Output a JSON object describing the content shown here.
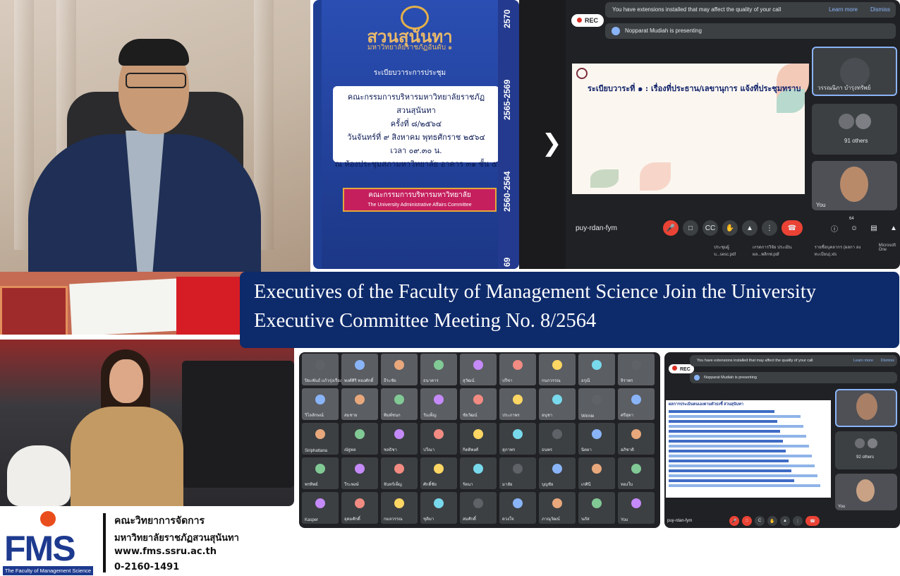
{
  "cover": {
    "brand_thai": "สวนสุนันทา",
    "brand_sub": "มหาวิทยาลัยราชภัฏอันดับ ๑",
    "agenda_heading": "ระเบียบวาระการประชุม",
    "lines": [
      "คณะกรรมการบริหารมหาวิทยาลัยราชภัฏสวนสุนันทา",
      "ครั้งที่ ๘/๒๕๖๔",
      "วันจันทร์ที่ ๙ สิงหาคม พุทธศักราช ๒๕๖๔",
      "เวลา ๐๙.๓๐ น.",
      "ณ ห้องประชุมสภามหาวิทยาลัย อาคาร ๓๑ ชั้น ๕"
    ],
    "ribbon_thai": "คณะกรรมการบริหารมหาวิทยาลัย",
    "ribbon_en": "The University Administrative Affairs Committee",
    "spine": [
      "2570",
      "2565-2569",
      "2560-2564",
      "69"
    ]
  },
  "meeting1": {
    "rec_label": "REC",
    "ext_text": "You have extensions installed that may affect the quality of your call",
    "learn_more": "Learn more",
    "dismiss": "Dismiss",
    "presenting": "Nopparat Mudiah is presenting",
    "slide_title": "ระเบียบวาระที่ ๑ : เรื่องที่ประธาน/เลขานุการ แจ้งที่ประชุมทราบ",
    "tile1_name": "วรรณนิภา บำรุงทรัพย์",
    "others": "91 others",
    "you": "You",
    "code": "puy-rdan-fym",
    "participant_count": "64",
    "files": [
      "ประชุมผู้บ...sesc.pdf",
      "เกรดการวิจัย ประเมินผล...พลิกฟ.pdf",
      "รายชื่อบุคลากร (ผลกา ลงทะเบียน).xls",
      "Microsoft One"
    ]
  },
  "banner": {
    "line1": "Executives of the Faculty of Management Science Join the University",
    "line2": "Executive Committee Meeting No. 8/2564"
  },
  "grid": {
    "rows": [
      [
        "ปิยะพันธ์ แก้วรุ่งเรือง",
        "พงศ์ศิริ ทองศักดิ์",
        "ธีระชัย",
        "ธนาคาร",
        "สุวัฒน์",
        "ปรีชา",
        "กนกวรรณ",
        "อรุณี",
        "จิราพร"
      ],
      [
        "วิไลลักษณ์",
        "สมชาย",
        "พิมพ์ชนก",
        "วันเพ็ญ",
        "ชัยวัฒน์",
        "ประภาพร",
        "อนุชา",
        "Winnie",
        "ศรีสุดา"
      ],
      [
        "Siriphattana",
        "ณัฐพล",
        "ชลธิชา",
        "ปวีณา",
        "กิตติพงศ์",
        "สุภาพร",
        "ธนพร",
        "นิตยา",
        "อภิชาติ"
      ],
      [
        "พรทิพย์",
        "วีระพงษ์",
        "จันทร์เพ็ญ",
        "ศักดิ์ชัย",
        "รัตนา",
        "มาลัย",
        "บุญชัย",
        "เกศินี",
        "ทองใบ"
      ],
      [
        "Kasper",
        "อุดมศักดิ์",
        "กมลวรรณ",
        "ชุติมา",
        "สมศักดิ์",
        "ดวงใจ",
        "ภาณุวัฒน์",
        "นภัส",
        "You"
      ]
    ]
  },
  "meeting2": {
    "rec_label": "REC",
    "ext_text": "You have extensions installed that may affect the quality of your call",
    "learn_more": "Learn more",
    "dismiss": "Dismiss",
    "presenting": "Nopparat Mudiah is presenting",
    "sheet_title": "ผลการประเมินตนเองตามตัวบ่งชี้ สวนสุนันทา",
    "others": "92 others",
    "you": "You",
    "code": "puy-rdan-fym"
  },
  "logo": {
    "text": "FMS",
    "sub": "The Faculty of Management Science"
  },
  "contact": {
    "faculty": "คณะวิทยาการจัดการ",
    "university": "มหาวิทยาลัยราชภัฏสวนสุนันทา",
    "web": "www.fms.ssru.ac.th",
    "phone": "0-2160-1491"
  },
  "colors": {
    "banner_bg": "#0d2a6b",
    "meet_bg": "#202124",
    "end_call": "#ea4335",
    "logo_blue": "#1d3a8f",
    "logo_orange": "#e94d1c"
  }
}
